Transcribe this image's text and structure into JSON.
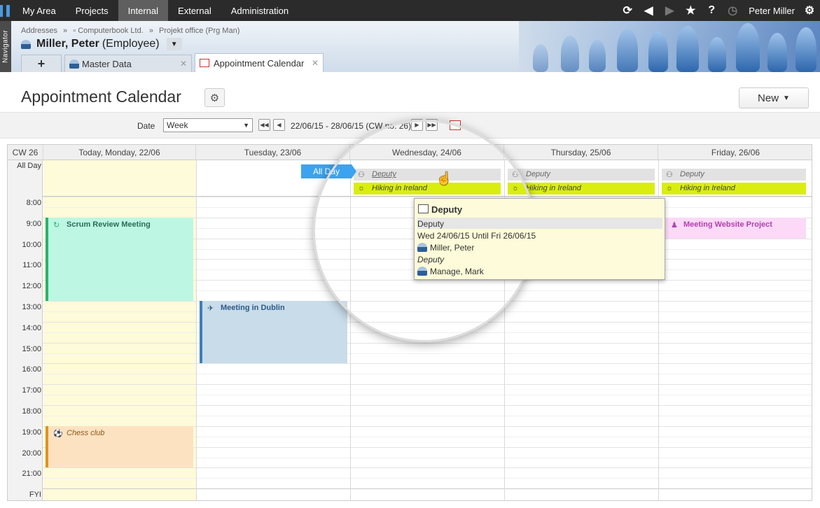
{
  "topnav": {
    "items": [
      "My Area",
      "Projects",
      "Internal",
      "External",
      "Administration"
    ],
    "active": "Internal",
    "user": "Peter Miller"
  },
  "navigator_label": "Navigator",
  "breadcrumb": {
    "items": [
      "Addresses",
      "Computerbook Ltd.",
      "Projekt office (Prg Man)"
    ],
    "separator": "»"
  },
  "entity": {
    "name": "Miller, Peter",
    "role": "(Employee)"
  },
  "tabs": {
    "master_data": "Master Data",
    "appointment_calendar": "Appointment Calendar",
    "plus": "+"
  },
  "page": {
    "title": "Appointment Calendar",
    "new_button": "New"
  },
  "toolbar": {
    "date_label": "Date",
    "view_selected": "Week",
    "range": "22/06/15 - 28/06/15 (CW no. 26)"
  },
  "calendar": {
    "week": "CW 26",
    "days": [
      "Today, Monday, 22/06",
      "Tuesday, 23/06",
      "Wednesday, 24/06",
      "Thursday, 25/06",
      "Friday, 26/06"
    ],
    "all_day_label": "All Day",
    "hours": [
      "8:00",
      "9:00",
      "10:00",
      "11:00",
      "12:00",
      "13:00",
      "14:00",
      "15:00",
      "16:00",
      "17:00",
      "18:00",
      "19:00",
      "20:00",
      "21:00"
    ],
    "fyi_label": "FYI",
    "all_day_badge": "All Day",
    "all_day_events": {
      "deputy": "Deputy",
      "hiking": "Hiking in Ireland"
    },
    "events": {
      "scrum": "Scrum Review Meeting",
      "dublin": "Meeting in Dublin",
      "website": "Meeting Website Project",
      "chess": "Chess club"
    }
  },
  "popup": {
    "title": "Deputy",
    "category": "Deputy",
    "dates": "Wed 24/06/15  Until  Fri 26/06/15",
    "person1": "Miller, Peter",
    "role": "Deputy",
    "person2": "Manage, Mark"
  },
  "colors": {
    "scrum": "#bdf7e4",
    "scrum_border": "#27b36e",
    "dublin": "#c9dcea",
    "dublin_border": "#3d7fbb",
    "website": "#fbd9f7",
    "website_text": "#b23fb0",
    "chess": "#fde2c2",
    "chess_border": "#e0931d",
    "hiking": "#d9ee0f",
    "deputy_bg": "#e2e2e2"
  }
}
